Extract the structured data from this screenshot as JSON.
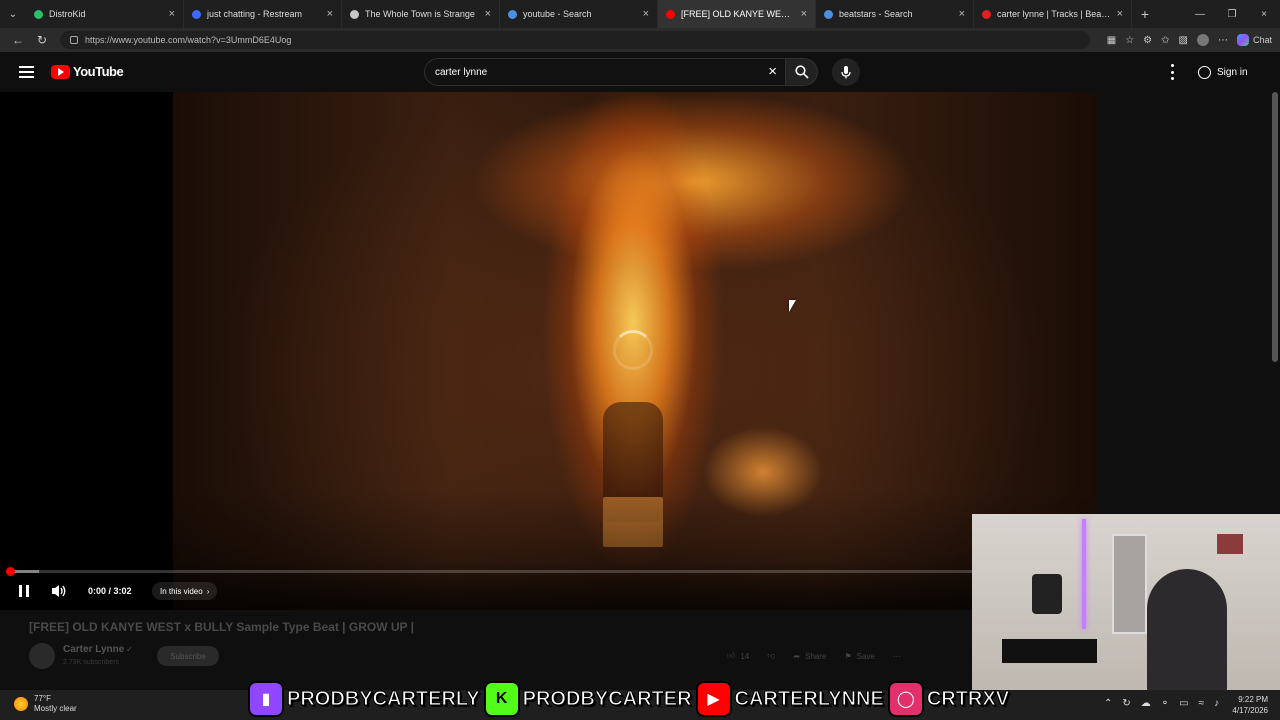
{
  "browser": {
    "tabs": [
      {
        "title": "DistroKid",
        "favicon_color": "#2bbf6a",
        "active": false
      },
      {
        "title": "just chatting - Restream",
        "favicon_color": "#3b6cff",
        "active": false
      },
      {
        "title": "The Whole Town is Strange",
        "favicon_color": "#c7c7c7",
        "active": false
      },
      {
        "title": "youtube - Search",
        "favicon_color": "#4a90e2",
        "active": false
      },
      {
        "title": "[FREE] OLD KANYE WEST x BULLY",
        "favicon_color": "#ff0000",
        "active": true
      },
      {
        "title": "beatstars - Search",
        "favicon_color": "#4a90e2",
        "active": false
      },
      {
        "title": "carter lynne | Tracks | BeatStars Pr",
        "favicon_color": "#e02020",
        "active": false
      }
    ],
    "url": "https://www.youtube.com/watch?v=3UmmD6E4Uog",
    "chat_label": "Chat"
  },
  "youtube": {
    "logo_text": "YouTube",
    "search_value": "carter lynne",
    "signin_label": "Sign in"
  },
  "player": {
    "time": "0:00 / 3:02",
    "chapter_label": "In this video",
    "progress_loaded": 0.03,
    "progress_played": 0.0
  },
  "video_info": {
    "title": "[FREE] OLD KANYE WEST x BULLY Sample Type Beat | GROW UP |",
    "channel": "Carter Lynne",
    "subscribers": "2.73K subscribers",
    "subscribe_label": "Subscribe",
    "likes": "14",
    "share_label": "Share",
    "save_label": "Save"
  },
  "overlay": {
    "socials": [
      {
        "platform": "twitch",
        "handle": "PRODBYCARTERLY",
        "icon_color": "#9146ff"
      },
      {
        "platform": "kick",
        "handle": "PRODBYCARTER",
        "icon_color": "#53fc18"
      },
      {
        "platform": "youtube",
        "handle": "CARTERLYNNE",
        "icon_color": "#ff0000"
      },
      {
        "platform": "instagram",
        "handle": "CRTRXV",
        "icon_color": "#e1306c"
      }
    ]
  },
  "taskbar": {
    "temperature": "77°F",
    "weather": "Mostly clear",
    "time": "9:22 PM",
    "date": "4/17/2026"
  }
}
